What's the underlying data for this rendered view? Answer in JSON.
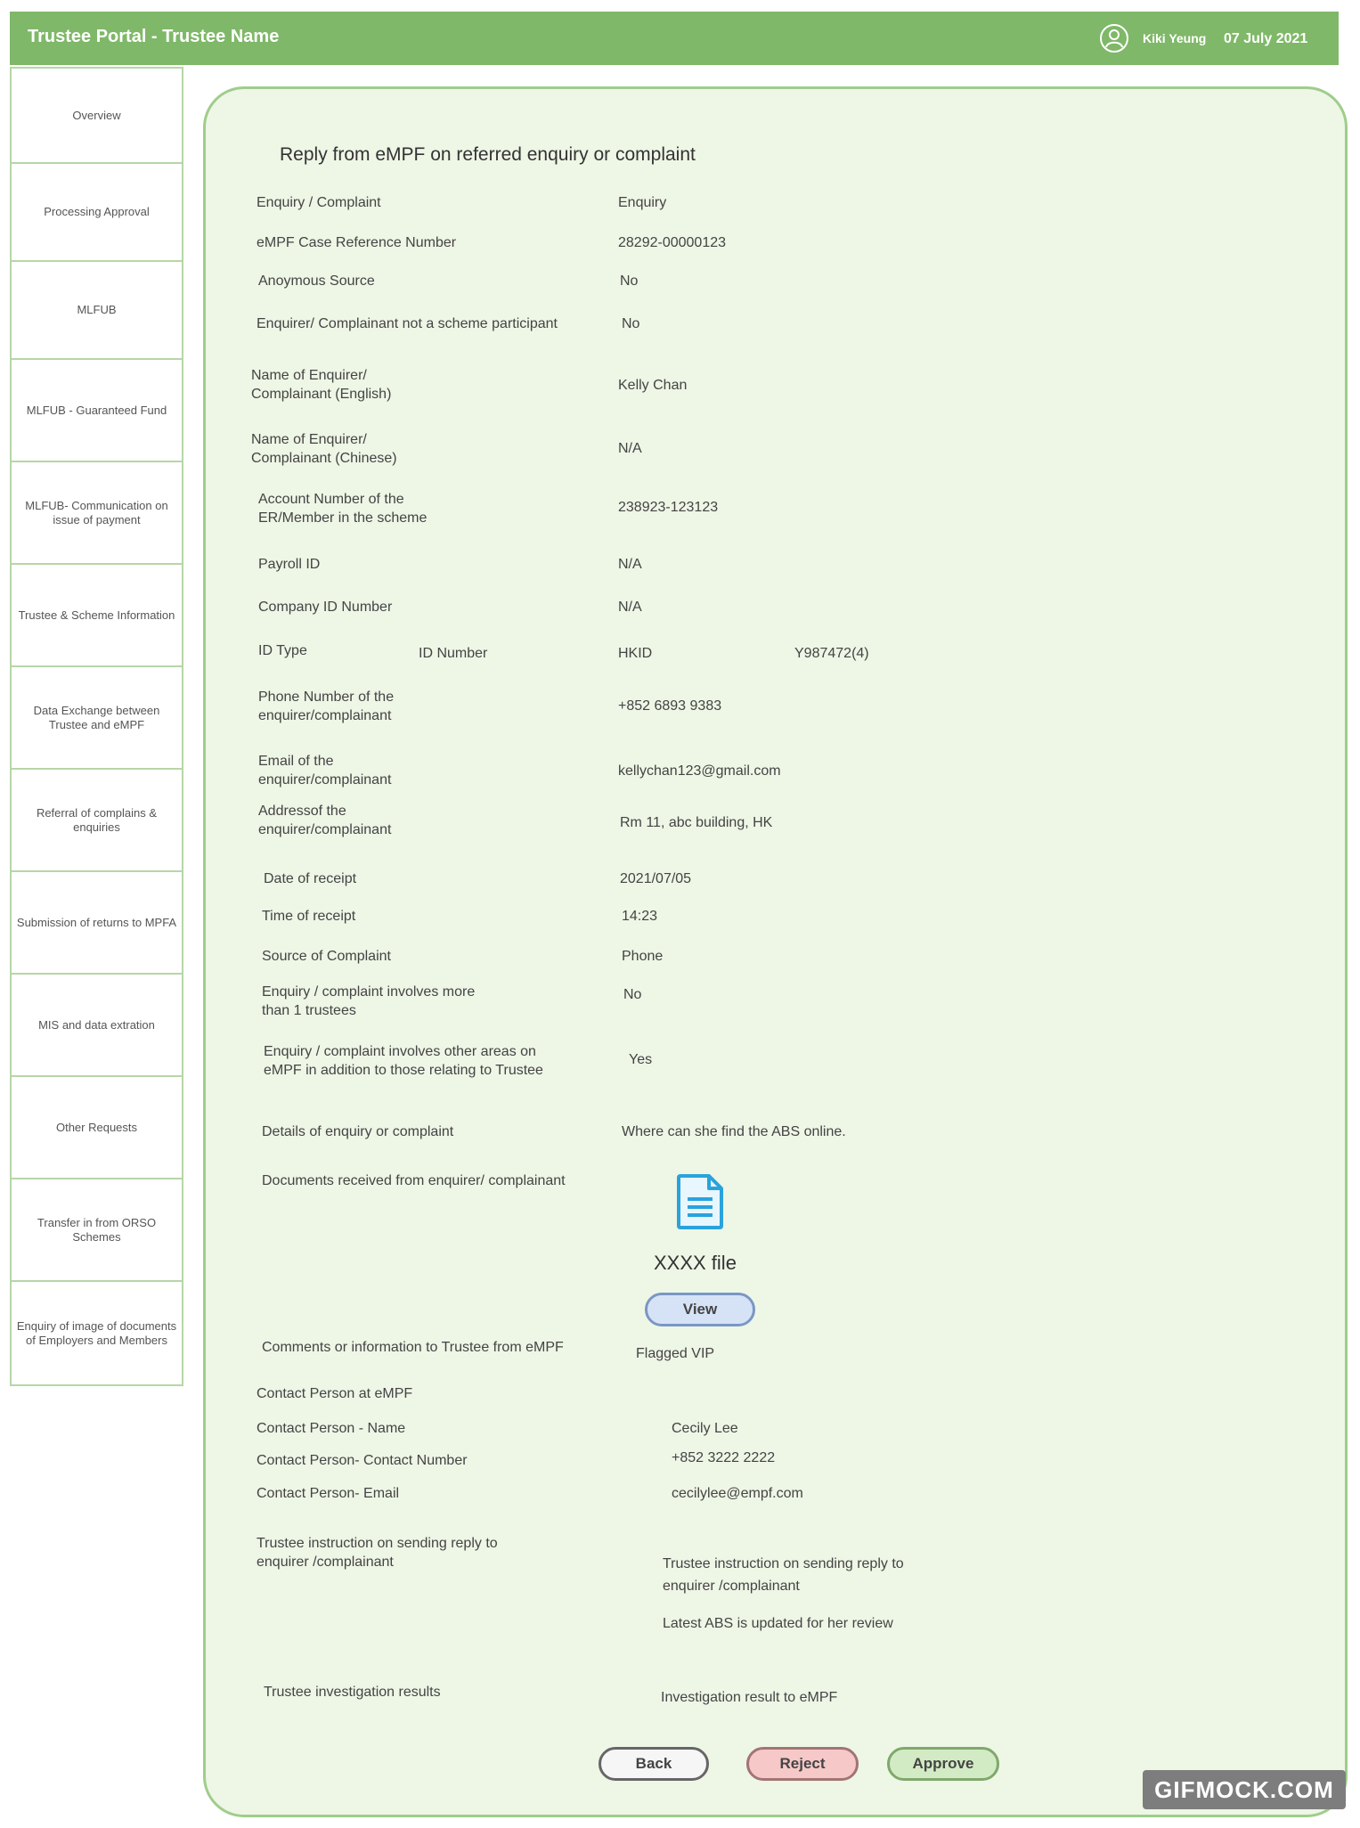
{
  "header": {
    "title": "Trustee Portal - Trustee Name",
    "user_name": "Kiki Yeung",
    "date": "07 July 2021",
    "user_icon": "user-avatar-icon"
  },
  "sidebar": {
    "items": [
      {
        "label": "Overview"
      },
      {
        "label": "Processing Approval"
      },
      {
        "label": "MLFUB"
      },
      {
        "label": "MLFUB - Guaranteed Fund"
      },
      {
        "label": "MLFUB- Communication on issue of payment"
      },
      {
        "label": "Trustee & Scheme Information"
      },
      {
        "label": "Data Exchange between Trustee and eMPF"
      },
      {
        "label": "Referral of complains & enquiries"
      },
      {
        "label": "Submission of returns to MPFA"
      },
      {
        "label": "MIS and data extration"
      },
      {
        "label": "Other Requests"
      },
      {
        "label": "Transfer in from ORSO Schemes"
      },
      {
        "label": "Enquiry of image of documents of Employers and Members"
      }
    ]
  },
  "main": {
    "heading": "Reply from eMPF on referred enquiry or complaint",
    "fields": {
      "type_label": "Enquiry / Complaint",
      "type_value": "Enquiry",
      "case_ref_label": "eMPF Case Reference Number",
      "case_ref_value": "28292-00000123",
      "anon_label": "Anoymous Source",
      "anon_value": "No",
      "not_participant_label": "Enquirer/ Complainant not a scheme participant",
      "not_participant_value": "No",
      "name_en_label_1": "Name of Enquirer/",
      "name_en_label_2": "Complainant (English)",
      "name_en_value": "Kelly Chan",
      "name_zh_label_1": "Name of Enquirer/",
      "name_zh_label_2": "Complainant (Chinese)",
      "name_zh_value": "N/A",
      "account_label_1": "Account Number of the",
      "account_label_2": "ER/Member in the scheme",
      "account_value": "238923-123123",
      "payroll_label": "Payroll ID",
      "payroll_value": "N/A",
      "company_label": "Company ID Number",
      "company_value": "N/A",
      "idtype_label": "ID Type",
      "idnumber_label": "ID Number",
      "idtype_value": "HKID",
      "idnumber_value": "Y987472(4)",
      "phone_label_1": "Phone Number of the",
      "phone_label_2": "enquirer/complainant",
      "phone_value": "+852 6893 9383",
      "email_label_1": "Email of the",
      "email_label_2": "enquirer/complainant",
      "email_value": "kellychan123@gmail.com",
      "address_label_1": "Addressof the",
      "address_label_2": "enquirer/complainant",
      "address_value": "Rm 11, abc building, HK",
      "date_label": "Date of receipt",
      "date_value": "2021/07/05",
      "time_label": "Time of receipt",
      "time_value": "14:23",
      "source_label": "Source of Complaint",
      "source_value": "Phone",
      "multi_label_1": "Enquiry / complaint involves more",
      "multi_label_2": "than 1 trustees",
      "multi_value": "No",
      "other_label_1": "Enquiry / complaint involves other areas on",
      "other_label_2": "eMPF in addition to those relating to Trustee",
      "other_value": "Yes",
      "details_label": "Details of enquiry or complaint",
      "details_value": "Where can she find the ABS online.",
      "docs_label": "Documents received from enquirer/ complainant",
      "file_name": "XXXX file",
      "file_icon": "document-icon",
      "comments_label": "Comments or information to Trustee from eMPF",
      "comments_value": "Flagged VIP",
      "contact_heading": "Contact Person at eMPF",
      "contact_name_label": "Contact Person - Name",
      "contact_name_value": "Cecily Lee",
      "contact_number_label": "Contact Person- Contact Number",
      "contact_number_value": "+852 3222 2222",
      "contact_email_label": "Contact Person- Email",
      "contact_email_value": "cecilylee@empf.com",
      "instruction_label_1": "Trustee instruction on sending reply to",
      "instruction_label_2": "enquirer /complainant",
      "instruction_value_1": "Trustee instruction on sending reply to",
      "instruction_value_2": "enquirer /complainant",
      "instruction_value_3": "Latest ABS is updated for her review",
      "investigation_label": "Trustee investigation results",
      "investigation_value": "Investigation result to eMPF"
    },
    "buttons": {
      "view": "View",
      "back": "Back",
      "reject": "Reject",
      "approve": "Approve"
    }
  },
  "watermark": "GIFMOCK.COM",
  "colors": {
    "header_bg": "#7fb868",
    "panel_bg": "#eef6e6",
    "panel_border": "#9fcd8b",
    "sidebar_border": "#b7d6a7",
    "reject_bg": "#f7c8c8",
    "approve_bg": "#d3ebc4",
    "view_bg": "#d6e3f7"
  }
}
